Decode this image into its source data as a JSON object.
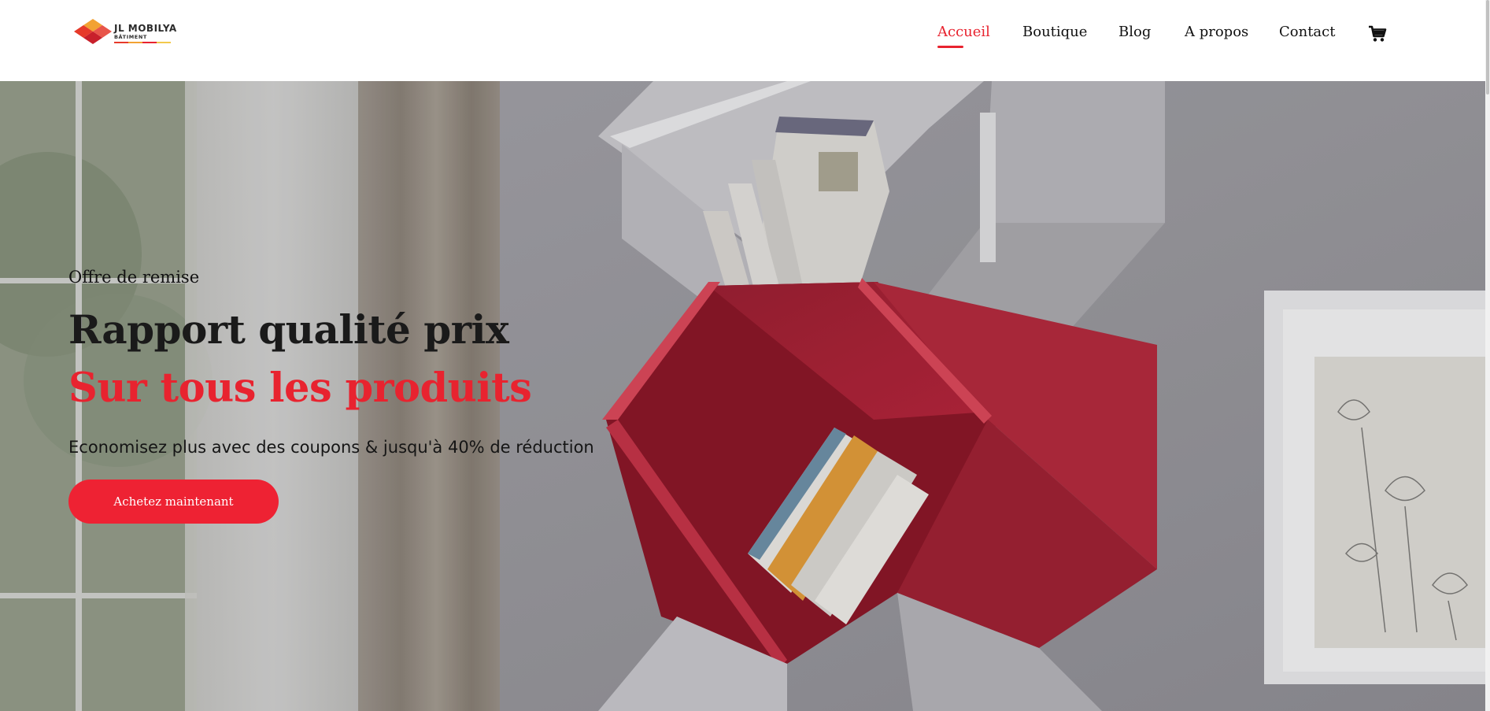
{
  "brand": {
    "name": "JL MOBILYA",
    "subtitle": "BÂTIMENT",
    "logo_colors": [
      "#e63a2a",
      "#f2a233",
      "#c8202b"
    ]
  },
  "nav": {
    "items": [
      {
        "label": "Accueil",
        "active": true
      },
      {
        "label": "Boutique",
        "active": false
      },
      {
        "label": "Blog",
        "active": false
      },
      {
        "label": "A propos",
        "active": false
      },
      {
        "label": "Contact",
        "active": false
      }
    ],
    "cart_icon": "shopping-cart-icon",
    "active_color": "#e8232f"
  },
  "hero": {
    "eyebrow": "Offre de remise",
    "headline": "Rapport qualité prix",
    "headline_accent": "Sur tous les produits",
    "subtitle": "Economisez plus avec des coupons & jusqu'à 40% de réduction",
    "cta_label": "Achetez maintenant",
    "accent_color": "#ee2233"
  }
}
